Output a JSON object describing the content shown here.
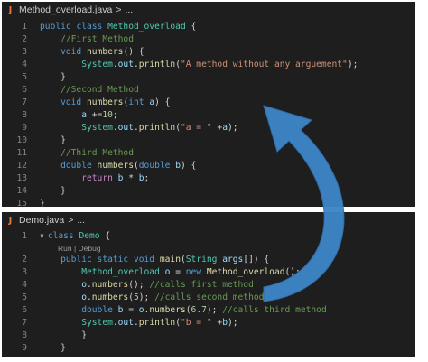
{
  "top_editor": {
    "breadcrumb": {
      "file": "Method_overload.java",
      "separator": ">",
      "symbol": "..."
    },
    "lines": [
      {
        "n": "1",
        "t": [
          [
            "kw",
            "public "
          ],
          [
            "kw",
            "class "
          ],
          [
            "ty",
            "Method_overload "
          ],
          [
            "plain",
            "{"
          ]
        ]
      },
      {
        "n": "2",
        "t": [
          [
            "plain",
            "    "
          ],
          [
            "cm",
            "//First Method"
          ]
        ]
      },
      {
        "n": "3",
        "t": [
          [
            "plain",
            "    "
          ],
          [
            "kw",
            "void "
          ],
          [
            "fn",
            "numbers"
          ],
          [
            "plain",
            "() {"
          ]
        ]
      },
      {
        "n": "4",
        "t": [
          [
            "plain",
            "        "
          ],
          [
            "ty",
            "System"
          ],
          [
            "plain",
            "."
          ],
          [
            "var",
            "out"
          ],
          [
            "plain",
            "."
          ],
          [
            "fn",
            "println"
          ],
          [
            "plain",
            "("
          ],
          [
            "str",
            "\"A method without any arguement\""
          ],
          [
            "plain",
            ");"
          ]
        ]
      },
      {
        "n": "5",
        "t": [
          [
            "plain",
            "    }"
          ]
        ]
      },
      {
        "n": "6",
        "t": [
          [
            "plain",
            "    "
          ],
          [
            "cm",
            "//Second Method"
          ]
        ]
      },
      {
        "n": "7",
        "t": [
          [
            "plain",
            "    "
          ],
          [
            "kw",
            "void "
          ],
          [
            "fn",
            "numbers"
          ],
          [
            "plain",
            "("
          ],
          [
            "kw",
            "int "
          ],
          [
            "var",
            "a"
          ],
          [
            "plain",
            ") {"
          ]
        ]
      },
      {
        "n": "8",
        "t": [
          [
            "plain",
            "        "
          ],
          [
            "var",
            "a"
          ],
          [
            "plain",
            " +="
          ],
          [
            "num",
            "10"
          ],
          [
            "plain",
            ";"
          ]
        ]
      },
      {
        "n": "9",
        "t": [
          [
            "plain",
            "        "
          ],
          [
            "ty",
            "System"
          ],
          [
            "plain",
            "."
          ],
          [
            "var",
            "out"
          ],
          [
            "plain",
            "."
          ],
          [
            "fn",
            "println"
          ],
          [
            "plain",
            "("
          ],
          [
            "str",
            "\"a = \""
          ],
          [
            "plain",
            " +"
          ],
          [
            "var",
            "a"
          ],
          [
            "plain",
            ");"
          ]
        ]
      },
      {
        "n": "10",
        "t": [
          [
            "plain",
            "    }"
          ]
        ]
      },
      {
        "n": "11",
        "t": [
          [
            "plain",
            "    "
          ],
          [
            "cm",
            "//Third Method"
          ]
        ]
      },
      {
        "n": "12",
        "t": [
          [
            "plain",
            "    "
          ],
          [
            "kw",
            "double "
          ],
          [
            "fn",
            "numbers"
          ],
          [
            "plain",
            "("
          ],
          [
            "kw",
            "double "
          ],
          [
            "var",
            "b"
          ],
          [
            "plain",
            ") {"
          ]
        ]
      },
      {
        "n": "13",
        "t": [
          [
            "plain",
            "        "
          ],
          [
            "ctrl",
            "return "
          ],
          [
            "var",
            "b"
          ],
          [
            "plain",
            " * "
          ],
          [
            "var",
            "b"
          ],
          [
            "plain",
            ";"
          ]
        ]
      },
      {
        "n": "14",
        "t": [
          [
            "plain",
            "    }"
          ]
        ]
      },
      {
        "n": "15",
        "t": [
          [
            "plain",
            "}"
          ]
        ]
      }
    ]
  },
  "bottom_editor": {
    "breadcrumb": {
      "file": "Demo.java",
      "separator": ">",
      "symbol": "..."
    },
    "codelens": "Run | Debug",
    "lines": [
      {
        "n": "1",
        "fold": "∨",
        "t": [
          [
            "kw",
            "class "
          ],
          [
            "ty",
            "Demo "
          ],
          [
            "plain",
            "{"
          ]
        ]
      },
      {
        "n": "2",
        "t": [
          [
            "plain",
            "    "
          ],
          [
            "kw",
            "public "
          ],
          [
            "kw",
            "static "
          ],
          [
            "kw",
            "void "
          ],
          [
            "fn",
            "main"
          ],
          [
            "plain",
            "("
          ],
          [
            "ty",
            "String "
          ],
          [
            "var",
            "args"
          ],
          [
            "plain",
            "[]) {"
          ]
        ]
      },
      {
        "n": "3",
        "t": [
          [
            "plain",
            "        "
          ],
          [
            "ty",
            "Method_overload "
          ],
          [
            "var",
            "o"
          ],
          [
            "plain",
            " = "
          ],
          [
            "kw",
            "new "
          ],
          [
            "fn",
            "Method_overload"
          ],
          [
            "plain",
            "();"
          ]
        ]
      },
      {
        "n": "4",
        "t": [
          [
            "plain",
            "        "
          ],
          [
            "var",
            "o"
          ],
          [
            "plain",
            "."
          ],
          [
            "fn",
            "numbers"
          ],
          [
            "plain",
            "(); "
          ],
          [
            "cm",
            "//calls first method"
          ]
        ]
      },
      {
        "n": "5",
        "t": [
          [
            "plain",
            "        "
          ],
          [
            "var",
            "o"
          ],
          [
            "plain",
            "."
          ],
          [
            "fn",
            "numbers"
          ],
          [
            "plain",
            "("
          ],
          [
            "num",
            "5"
          ],
          [
            "plain",
            "); "
          ],
          [
            "cm",
            "//calls second method"
          ]
        ]
      },
      {
        "n": "6",
        "t": [
          [
            "plain",
            "        "
          ],
          [
            "kw",
            "double "
          ],
          [
            "var",
            "b"
          ],
          [
            "plain",
            " = "
          ],
          [
            "var",
            "o"
          ],
          [
            "plain",
            "."
          ],
          [
            "fn",
            "numbers"
          ],
          [
            "plain",
            "("
          ],
          [
            "num",
            "6.7"
          ],
          [
            "plain",
            "); "
          ],
          [
            "cm",
            "//calls third method"
          ]
        ]
      },
      {
        "n": "7",
        "t": [
          [
            "plain",
            "        "
          ],
          [
            "ty",
            "System"
          ],
          [
            "plain",
            "."
          ],
          [
            "var",
            "out"
          ],
          [
            "plain",
            "."
          ],
          [
            "fn",
            "println"
          ],
          [
            "plain",
            "("
          ],
          [
            "str",
            "\"b = \""
          ],
          [
            "plain",
            " +"
          ],
          [
            "var",
            "b"
          ],
          [
            "plain",
            ");"
          ]
        ]
      },
      {
        "n": "8",
        "t": [
          [
            "plain",
            "        }"
          ]
        ]
      },
      {
        "n": "9",
        "t": [
          [
            "plain",
            "    }"
          ]
        ]
      }
    ]
  },
  "colors": {
    "editor_bg": "#1e1e1e",
    "keyword": "#569cd6",
    "type": "#4ec9b0",
    "function": "#dcdcaa",
    "string": "#ce9178",
    "comment": "#6a9955",
    "number": "#b5cea8",
    "variable": "#9cdcfe",
    "arrow": "#3d85c6"
  },
  "icons": {
    "file": "java-file-icon",
    "arrow": "curved-arrow-icon"
  }
}
